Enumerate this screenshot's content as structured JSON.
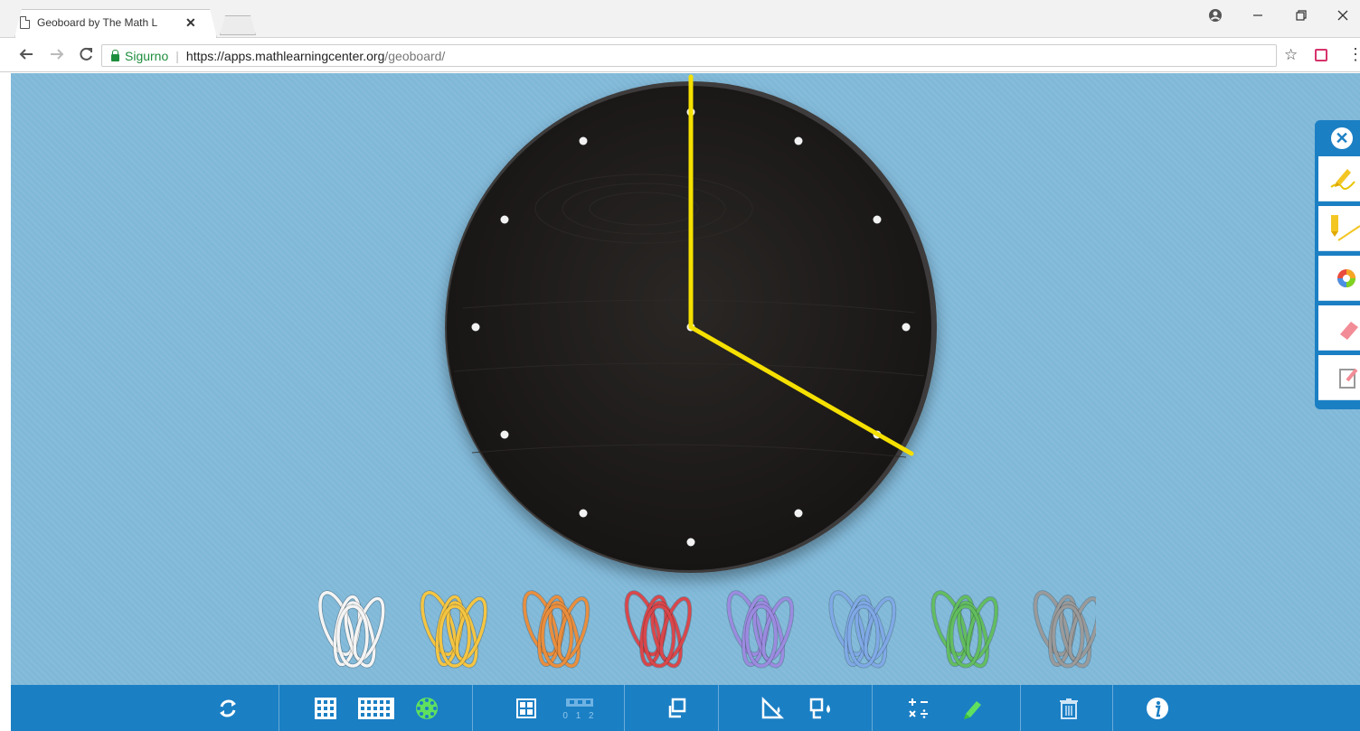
{
  "browser": {
    "tab_title": "Geoboard by The Math L",
    "tab_close": "✕",
    "secure_label": "Sigurno",
    "url_host": "https://apps.mathlearningcenter.org",
    "url_path": "/geoboard/",
    "icons": [
      "back-icon",
      "forward-icon",
      "reload-icon",
      "lock-icon",
      "star-icon",
      "extension-icon",
      "menu-icon",
      "account-icon",
      "minimize-icon",
      "restore-icon",
      "close-icon"
    ]
  },
  "colors": {
    "background": "#80b8d8",
    "toolbar": "#1b7fc4",
    "board": "#1e1c1b",
    "rubber_band_line": "#f5e000"
  },
  "clock_board": {
    "shape": "circle",
    "pegs": 12,
    "center_peg": true,
    "band_description": "yellow band connecting 12-o'clock peg, center peg and 4-o'clock peg"
  },
  "rubber_bands": [
    "white",
    "yellow",
    "orange",
    "red",
    "purple",
    "blue",
    "green",
    "gray"
  ],
  "rubber_band_colors": [
    "#f4f4f4",
    "#f4c542",
    "#e98e3e",
    "#d9474b",
    "#9b8be0",
    "#7fa9e6",
    "#62bd5f",
    "#9a9a9a"
  ],
  "side_panel_tools": [
    "close-panel-icon",
    "pencil-draw-icon",
    "marker-line-icon",
    "color-wheel-icon",
    "eraser-icon",
    "text-note-icon"
  ],
  "toolbar_tools": [
    "refresh-icon",
    "small-grid-icon",
    "large-grid-icon",
    "circle-board-icon",
    "grid-toggle-icon",
    "number-labels-icon",
    "duplicate-shape-icon",
    "fill-shape-icon",
    "fill-all-icon",
    "measure-icon",
    "highlighter-icon",
    "trash-icon",
    "info-icon"
  ],
  "toolbar_labels": {
    "number_labels": "0 1 2"
  }
}
